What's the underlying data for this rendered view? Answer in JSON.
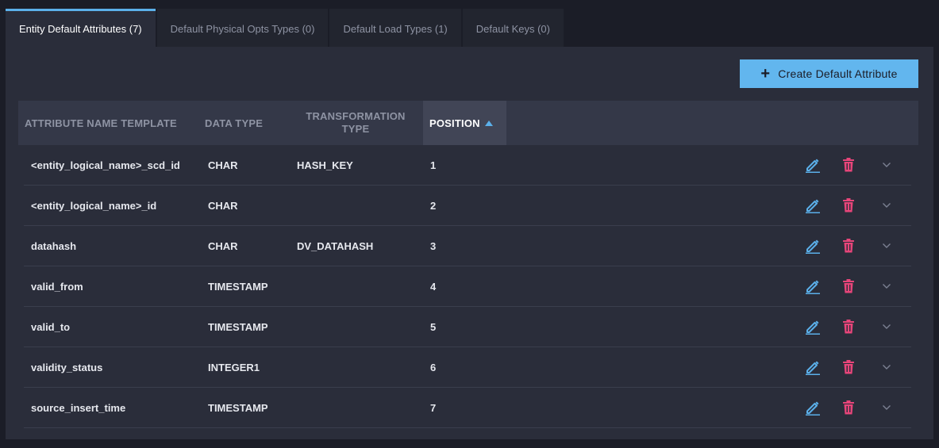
{
  "tabs": [
    {
      "label": "Entity Default Attributes (7)",
      "active": true
    },
    {
      "label": "Default Physical Opts Types (0)",
      "active": false
    },
    {
      "label": "Default Load Types (1)",
      "active": false
    },
    {
      "label": "Default Keys (0)",
      "active": false
    }
  ],
  "toolbar": {
    "create_label": "Create Default Attribute",
    "create_icon": "plus-icon"
  },
  "table": {
    "columns": [
      {
        "label": "ATTRIBUTE NAME TEMPLATE"
      },
      {
        "label": "DATA TYPE"
      },
      {
        "label": "TRANSFORMATION TYPE"
      },
      {
        "label": "POSITION",
        "sorted": "ascending"
      }
    ],
    "rows": [
      {
        "name": "<entity_logical_name>_scd_id",
        "data_type": "CHAR",
        "transformation": "HASH_KEY",
        "position": "1"
      },
      {
        "name": "<entity_logical_name>_id",
        "data_type": "CHAR",
        "transformation": "",
        "position": "2"
      },
      {
        "name": "datahash",
        "data_type": "CHAR",
        "transformation": "DV_DATAHASH",
        "position": "3"
      },
      {
        "name": "valid_from",
        "data_type": "TIMESTAMP",
        "transformation": "",
        "position": "4"
      },
      {
        "name": "valid_to",
        "data_type": "TIMESTAMP",
        "transformation": "",
        "position": "5"
      },
      {
        "name": "validity_status",
        "data_type": "INTEGER1",
        "transformation": "",
        "position": "6"
      },
      {
        "name": "source_insert_time",
        "data_type": "TIMESTAMP",
        "transformation": "",
        "position": "7"
      }
    ],
    "row_actions": [
      "edit-icon",
      "trash-icon",
      "chevron-down-icon"
    ]
  },
  "colors": {
    "accent": "#5bb0ea",
    "button_bg": "#62b6ee",
    "delete": "#e8457a",
    "background": "#1b1d27",
    "panel": "#2a2d3a"
  }
}
